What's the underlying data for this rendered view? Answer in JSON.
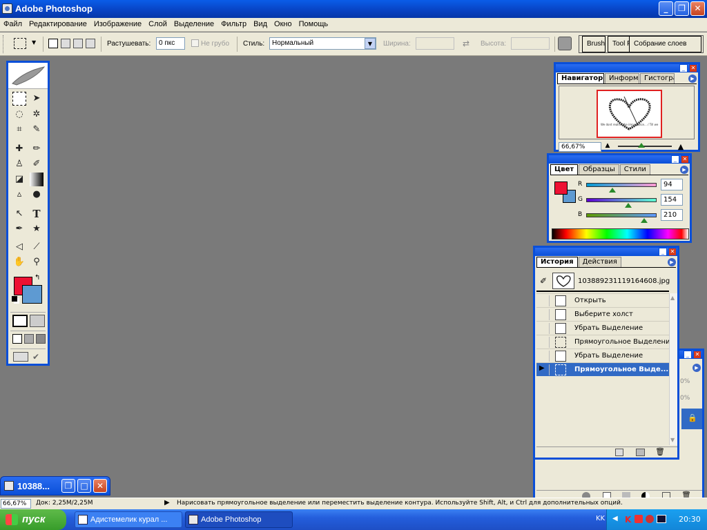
{
  "app": {
    "title": "Adobe Photoshop"
  },
  "menu": [
    "Файл",
    "Редактирование",
    "Изображение",
    "Слой",
    "Выделение",
    "Фильтр",
    "Вид",
    "Окно",
    "Помощь"
  ],
  "options": {
    "feather_label": "Растушевать:",
    "feather_value": "0 пкс",
    "antialias_label": "Не грубо",
    "style_label": "Стиль:",
    "style_value": "Нормальный",
    "width_label": "Ширина:",
    "height_label": "Высота:"
  },
  "palette_well": [
    "Brushes",
    "Tool Presets",
    "Собрание слоев"
  ],
  "navigator": {
    "tabs": [
      "Навигатор",
      "Информация",
      "Гистограмма"
    ],
    "zoom": "66,67%",
    "thumb_caption": "We dont realise the importance... / Till we miss them"
  },
  "color": {
    "tabs": [
      "Цвет",
      "Образцы",
      "Стили"
    ],
    "channels": [
      {
        "label": "R",
        "value": "94",
        "frac": 0.37
      },
      {
        "label": "G",
        "value": "154",
        "frac": 0.6
      },
      {
        "label": "B",
        "value": "210",
        "frac": 0.82
      }
    ],
    "fg": "#ee1133",
    "bg": "#5e9ad2"
  },
  "history": {
    "tabs": [
      "История",
      "Действия"
    ],
    "snapshot": "103889231119164608.jpg",
    "items": [
      "Открыть",
      "Выберите холст",
      "Убрать Выделение",
      "Прямоугольное Выделение",
      "Убрать Выделение",
      "Прямоугольное Выде..."
    ],
    "selected_index": 5
  },
  "layers_partial": {
    "a": "0%",
    "b": "0%"
  },
  "doc_min": {
    "title": "10388..."
  },
  "status": {
    "zoom": "66,67%",
    "doc": "Док: 2,25M/2,25M",
    "hint": "Нарисовать прямоугольное выделение или переместить выделение контура. Используйте Shift, Alt, и Ctrl для дополнительных опций."
  },
  "taskbar": {
    "start": "пуск",
    "items": [
      "Адистемелик курал ...",
      "Adobe Photoshop"
    ],
    "lang": "KK",
    "clock": "20:30"
  }
}
